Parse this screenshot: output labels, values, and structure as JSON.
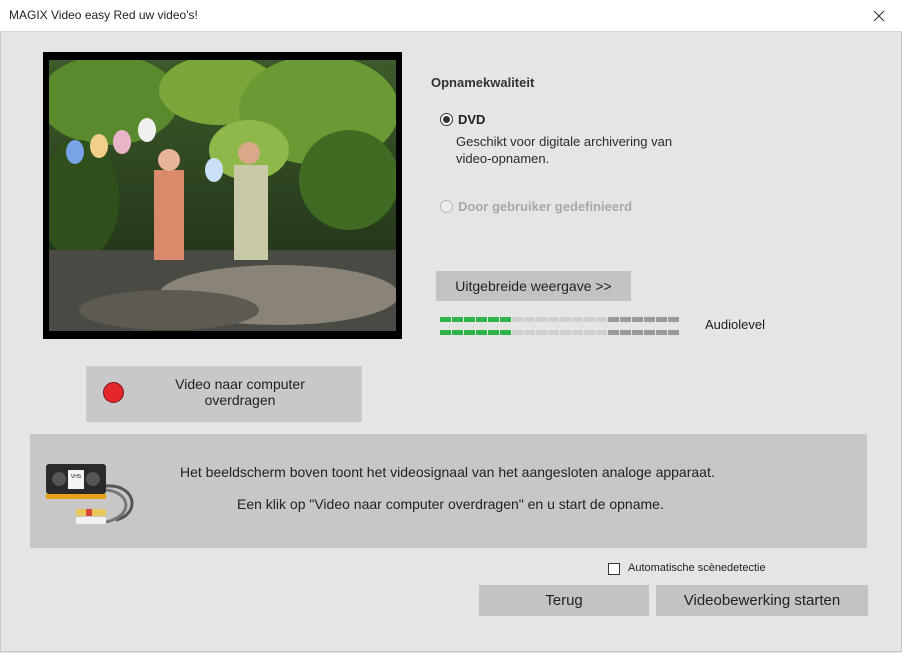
{
  "window": {
    "title": "MAGIX Video easy Red uw video's!"
  },
  "quality": {
    "heading": "Opnamekwaliteit",
    "options": [
      {
        "label": "DVD",
        "description_line1": "Geschikt voor digitale archivering van",
        "description_line2": "video-opnamen.",
        "selected": true,
        "enabled": true
      },
      {
        "label": "Door gebruiker gedefinieerd",
        "selected": false,
        "enabled": false
      }
    ]
  },
  "extended_view_button": "Uitgebreide weergave >>",
  "audio": {
    "label": "Audiolevel",
    "level_fraction": 0.3,
    "colors": {
      "active": "#2db34a",
      "inactive": "#cfcfcf",
      "peak": "#9a9a9a"
    }
  },
  "record_button": {
    "line1": "Video naar computer",
    "line2": "overdragen",
    "icon": "record-icon",
    "color": "#e5262b"
  },
  "info": {
    "line1": "Het beeldscherm boven toont het videosignaal van het aangesloten analoge apparaat.",
    "line2": "Een klik op \"Video naar computer overdragen\" en u start de opname.",
    "vhs_label": "VHS"
  },
  "auto_scene": {
    "label": "Automatische scènedetectie",
    "checked": false
  },
  "buttons": {
    "back": "Terug",
    "start": "Videobewerking starten"
  }
}
